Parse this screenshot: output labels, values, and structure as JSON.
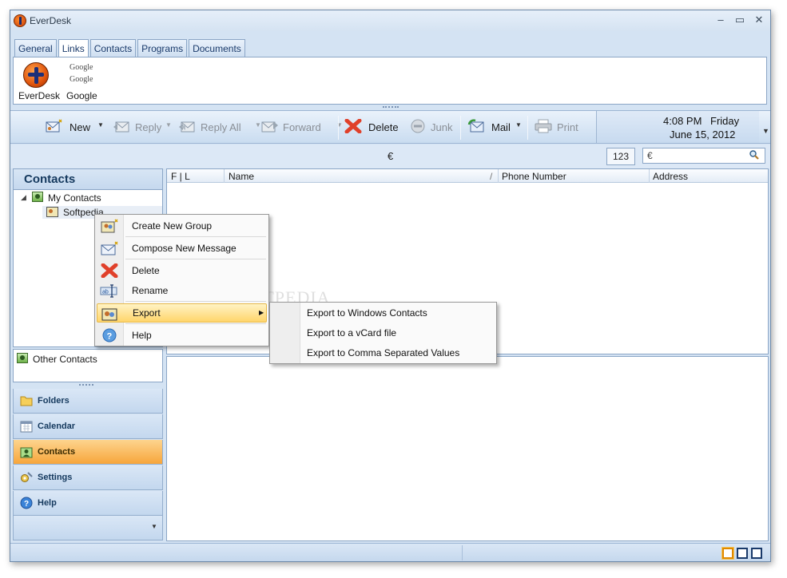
{
  "window": {
    "title": "EverDesk",
    "minimize": "–",
    "maximize": "▭",
    "close": "✕"
  },
  "ribbon": {
    "tabs": [
      "General",
      "Links",
      "Contacts",
      "Programs",
      "Documents"
    ],
    "active_tab": "Links",
    "links": [
      {
        "label": "EverDesk"
      },
      {
        "label": "Google",
        "logo_lines": [
          "Google",
          "Google"
        ]
      }
    ]
  },
  "toolbar": {
    "new": "New",
    "reply": "Reply",
    "reply_all": "Reply All",
    "forward": "Forward",
    "delete": "Delete",
    "junk": "Junk",
    "mail": "Mail",
    "print": "Print",
    "dropdown_arrow": "▼"
  },
  "clock": {
    "time": "4:08 PM",
    "day": "Friday",
    "date": "June 15, 2012"
  },
  "search": {
    "currency_label": "€",
    "number_button": "123",
    "value": "€"
  },
  "left_panel": {
    "title": "Contacts",
    "tree": {
      "expander": "◢",
      "root": "My Contacts",
      "child": "Softpedia"
    },
    "other": "Other Contacts",
    "nav": [
      {
        "label": "Folders"
      },
      {
        "label": "Calendar"
      },
      {
        "label": "Contacts",
        "active": true
      },
      {
        "label": "Settings"
      },
      {
        "label": "Help"
      }
    ]
  },
  "grid": {
    "columns": [
      "F | L",
      "Name",
      "Phone Number",
      "Address"
    ],
    "sort_indicator": "/"
  },
  "context_menu": {
    "items": [
      "Create New Group",
      "Compose New Message",
      "Delete",
      "Rename",
      "Export",
      "Help"
    ],
    "highlighted": "Export",
    "submenu_arrow": "▶"
  },
  "submenu": {
    "items": [
      "Export to Windows Contacts",
      "Export to a vCard file",
      "Export to Comma Separated Values"
    ]
  },
  "watermark": "SOFTPEDIA"
}
